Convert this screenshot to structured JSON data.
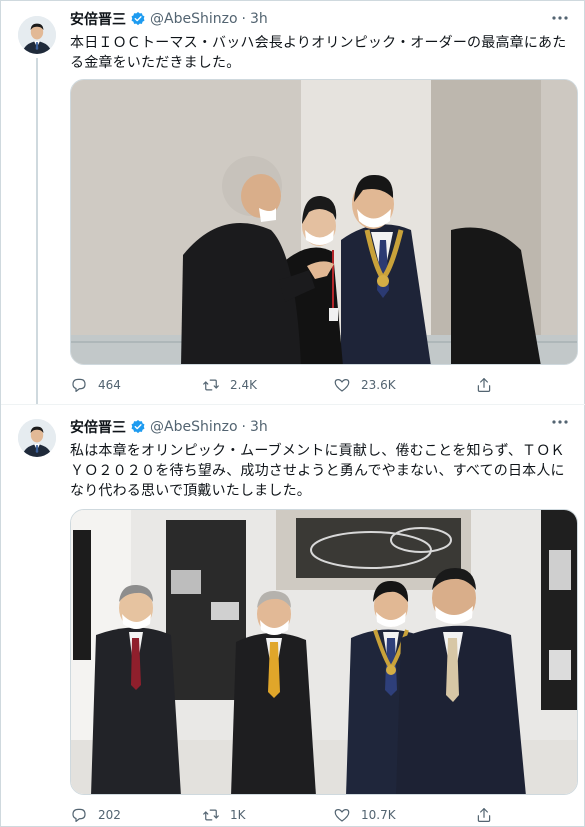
{
  "tweets": [
    {
      "author_name": "安倍晋三",
      "handle": "@AbeShinzo",
      "separator": "·",
      "time": "3h",
      "text": "本日ＩＯＣトーマス・バッハ会長よりオリンピック・オーダーの最高章にあたる金章をいただきました。",
      "replies": "464",
      "retweets": "2.4K",
      "likes": "23.6K"
    },
    {
      "author_name": "安倍晋三",
      "handle": "@AbeShinzo",
      "separator": "·",
      "time": "3h",
      "text": "私は本章をオリンピック・ムーブメントに貢献し、倦むことを知らず、ＴＯＫＹＯ２０２０を待ち望み、成功させようと勇んでやまない、すべての日本人になり代わる思いで頂戴いたしました。",
      "replies": "202",
      "retweets": "1K",
      "likes": "10.7K"
    }
  ],
  "icons": {
    "verified": "verified-badge-icon",
    "more": "more-icon",
    "reply": "reply-icon",
    "retweet": "retweet-icon",
    "like": "like-icon",
    "share": "share-icon"
  },
  "colors": {
    "verified_blue": "#1d9bf0",
    "secondary_text": "#536471",
    "divider": "#cfd9de"
  }
}
